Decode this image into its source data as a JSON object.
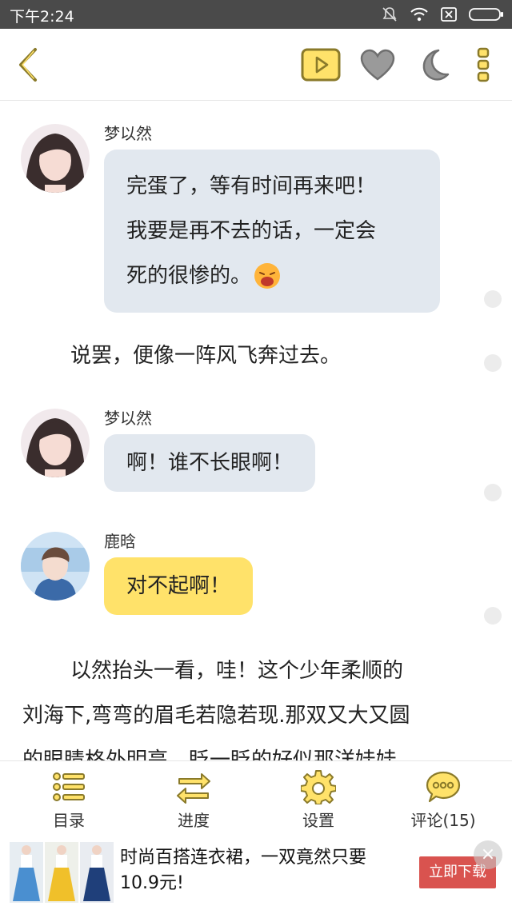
{
  "statusbar": {
    "time": "下午2:24"
  },
  "messages": [
    {
      "sender": "梦以然",
      "lines": [
        "完蛋了，等有时间再来吧！",
        "我要是再不去的话，一定会",
        "死的很惨的。"
      ]
    },
    {
      "narration": "说罢，便像一阵风飞奔过去。"
    },
    {
      "sender": "梦以然",
      "lines": [
        "啊！谁不长眼啊！"
      ]
    },
    {
      "sender": "鹿晗",
      "lines": [
        "对不起啊！"
      ]
    },
    {
      "narration_lines": [
        "以然抬头一看，哇！这个少年柔顺的",
        "刘海下,弯弯的眉毛若隐若现.那双又大又圆",
        "的眼睛格外明亮，眨一眨的好似那洋娃娃"
      ]
    }
  ],
  "nav": [
    {
      "label": "目录",
      "icon": "list-icon"
    },
    {
      "label": "进度",
      "icon": "progress-arrows-icon"
    },
    {
      "label": "设置",
      "icon": "gear-icon"
    },
    {
      "label": "评论(15)",
      "icon": "comment-icon"
    }
  ],
  "ad": {
    "text": "时尚百搭连衣裙，一双竟然只要10.9元!",
    "cta": "立即下载",
    "close": "×"
  },
  "colors": {
    "accent": "#ffe26a",
    "bubble_gray": "#e2e8ef",
    "icon_olive": "#8a7a2a"
  }
}
